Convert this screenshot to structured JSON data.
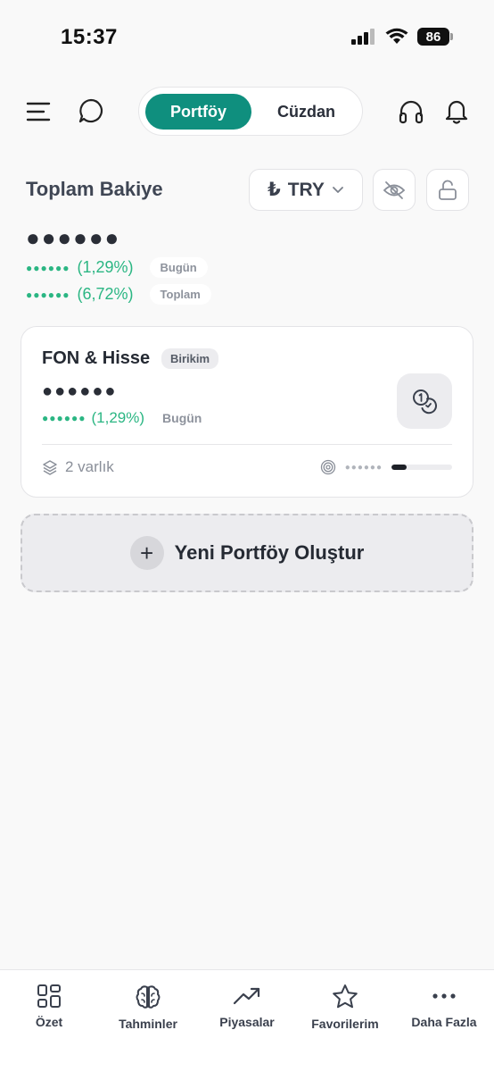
{
  "status_bar": {
    "time": "15:37",
    "battery": "86"
  },
  "header": {
    "tabs": {
      "active": "Portföy",
      "inactive": "Cüzdan"
    }
  },
  "balance": {
    "title": "Toplam Bakiye",
    "currency_symbol": "₺",
    "currency": "TRY",
    "masked_value": "●●●●●●",
    "changes": [
      {
        "dots": "●●●●●●",
        "value": "(1,29%)",
        "label": "Bugün"
      },
      {
        "dots": "●●●●●●",
        "value": "(6,72%)",
        "label": "Toplam"
      }
    ]
  },
  "portfolio_card": {
    "title": "FON & Hisse",
    "tag": "Birikim",
    "masked_value": "●●●●●●",
    "change_dots": "●●●●●●",
    "change_value": "(1,29%)",
    "change_label": "Bugün",
    "assets": "2 varlık",
    "target_dots": "●●●●●●",
    "progress": 0.25
  },
  "new_portfolio": {
    "label": "Yeni Portföy Oluştur",
    "plus": "+"
  },
  "tabbar": {
    "items": [
      {
        "label": "Özet",
        "icon": "grid-icon"
      },
      {
        "label": "Tahminler",
        "icon": "brain-icon"
      },
      {
        "label": "Piyasalar",
        "icon": "trending-up-icon"
      },
      {
        "label": "Favorilerim",
        "icon": "star-icon"
      },
      {
        "label": "Daha Fazla",
        "icon": "more-icon"
      }
    ]
  },
  "colors": {
    "accent": "#0f8f7e",
    "positive": "#2bb683"
  }
}
